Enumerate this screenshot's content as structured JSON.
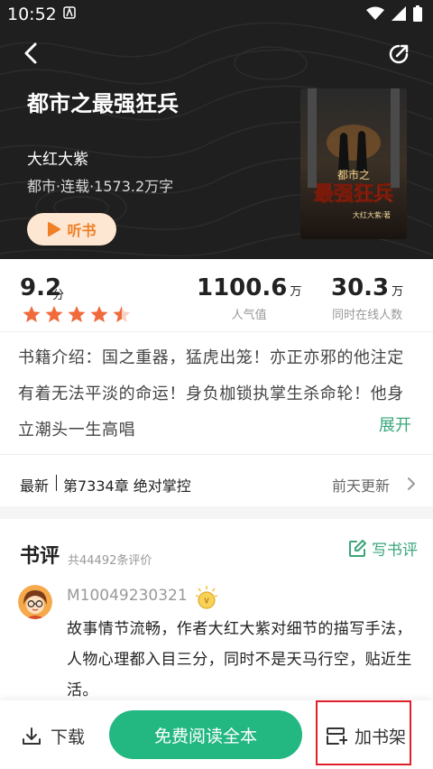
{
  "status_bar": {
    "time": "10:52"
  },
  "book": {
    "title": "都市之最强狂兵",
    "author": "大红大紫",
    "meta": "都市·连载·1573.2万字",
    "listen_label": "听书",
    "cover_text_small": "都市之",
    "cover_text_big": "最强狂兵",
    "cover_author": "大红大紫/著"
  },
  "stats": {
    "rating": "9.2",
    "rating_unit": "分",
    "rating_value": 4.5,
    "popularity": "1100.6",
    "popularity_unit": "万",
    "popularity_label": "人气值",
    "online": "30.3",
    "online_unit": "万",
    "online_label": "同时在线人数"
  },
  "intro": {
    "text": "书籍介绍：国之重器，猛虎出笼！亦正亦邪的他注定有着无法平淡的命运！身负枷锁执掌生杀命轮！他身立潮头一生高唱",
    "expand_label": "展开"
  },
  "latest": {
    "tag": "最新",
    "chapter": "第7334章 绝对掌控",
    "update": "前天更新"
  },
  "reviews": {
    "title": "书评",
    "count": "共44492条评价",
    "write_label": "写书评",
    "items": [
      {
        "user": "M10049230321",
        "text": "故事情节流畅，作者大红大紫对细节的描写手法，人物心理都入目三分，同时不是天马行空，贴近生活。"
      }
    ]
  },
  "bottom_bar": {
    "download_label": "下载",
    "read_label": "免费阅读全本",
    "shelf_label": "加书架"
  },
  "colors": {
    "accent_green": "#23b782",
    "link_green": "#3aa67a",
    "listen_orange": "#f07f26",
    "star_orange": "#f06a3c",
    "highlight_red": "#e0212b"
  }
}
